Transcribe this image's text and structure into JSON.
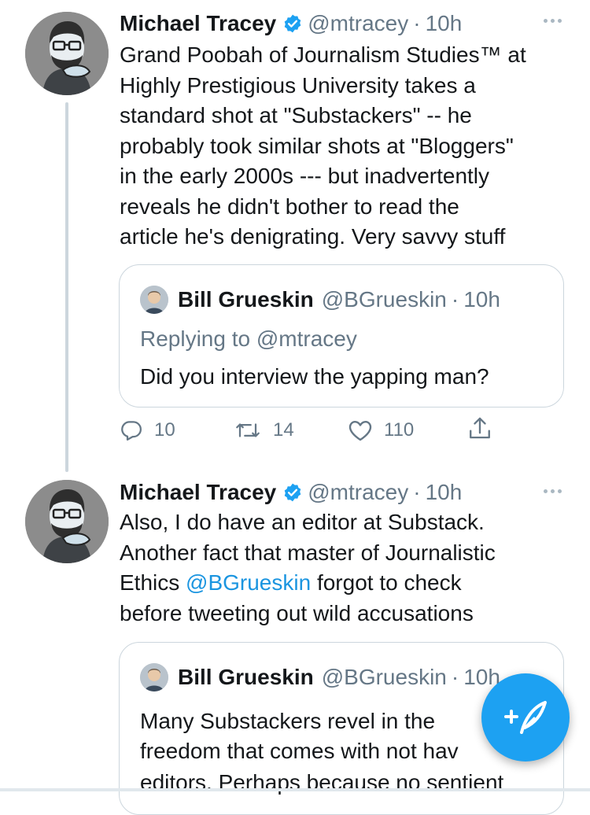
{
  "tweets": [
    {
      "name": "Michael Tracey",
      "handle": "@mtracey",
      "separator": "·",
      "time": "10h",
      "body_lines": [
        "Grand Poobah of Journalism Studies™ at",
        "Highly Prestigious University takes a",
        "standard shot at \"Substackers\" -- he",
        "probably took similar shots at \"Bloggers\"",
        "in the early 2000s --- but inadvertently",
        "reveals he didn't bother to read the",
        "article he's denigrating. Very savvy stuff"
      ],
      "quote": {
        "name": "Bill Grueskin",
        "handle": "@BGrueskin",
        "separator": "·",
        "time": "10h",
        "replying_to": "Replying to @mtracey",
        "text": "Did you interview the yapping man?"
      },
      "actions": {
        "replies": "10",
        "retweets": "14",
        "likes": "110"
      }
    },
    {
      "name": "Michael Tracey",
      "handle": "@mtracey",
      "separator": "·",
      "time": "10h",
      "body": {
        "line1": "Also, I do have an editor at Substack.",
        "line2": "Another fact that master of Journalistic",
        "line3_prefix": "Ethics ",
        "line3_mention": "@BGrueskin",
        "line3_suffix": " forgot to check",
        "line4": "before tweeting out wild accusations"
      },
      "quote": {
        "name": "Bill Grueskin",
        "handle": "@BGrueskin",
        "separator": "·",
        "time": "10h",
        "text_lines": [
          "Many Substackers revel in the",
          "freedom that comes with not hav",
          "editors. Perhaps because no sentient"
        ]
      }
    }
  ],
  "icons": {
    "verified": "verified-badge-icon",
    "more": "more-dots-icon",
    "reply": "reply-icon",
    "retweet": "retweet-icon",
    "like": "heart-icon",
    "share": "share-icon",
    "compose": "compose-tweet-icon"
  },
  "colors": {
    "accent": "#1da1f2",
    "mention": "#1b95e0",
    "secondary_text": "#657786",
    "border": "#ccd6dd"
  }
}
